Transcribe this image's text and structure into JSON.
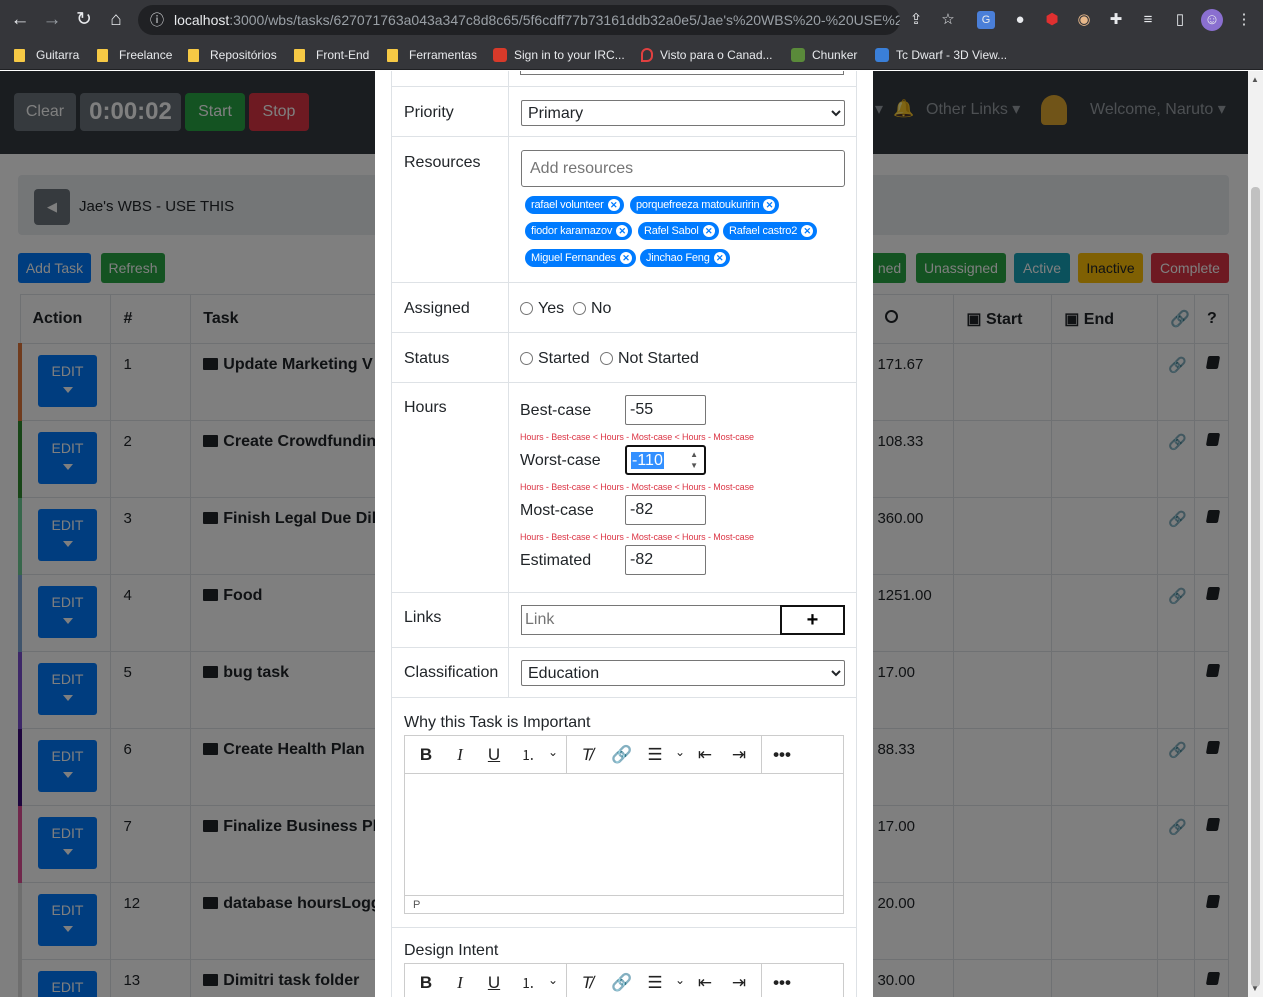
{
  "browser": {
    "url_host": "localhost",
    "url_rest": ":3000/wbs/tasks/627071763a043a347c8d8c65/5f6cdff77b73161ddb32a0e5/Jae's%20WBS%20-%20USE%2...",
    "bookmarks": [
      "Guitarra",
      "Freelance",
      "Repositórios",
      "Front-End",
      "Ferramentas",
      "Sign in to your IRC...",
      "Visto para o Canad...",
      "Chunker",
      "Tc Dwarf - 3D View..."
    ]
  },
  "topbar": {
    "clear": "Clear",
    "timer": "0:00:02",
    "start": "Start",
    "stop": "Stop",
    "other_links": "Other Links",
    "welcome": "Welcome, Naruto"
  },
  "breadcrumb": {
    "title": "Jae's WBS - USE THIS"
  },
  "filters": {
    "add_task": "Add Task",
    "refresh": "Refresh",
    "assigned": "ned",
    "unassigned": "Unassigned",
    "active": "Active",
    "inactive": "Inactive",
    "complete": "Complete"
  },
  "table": {
    "headers": {
      "action": "Action",
      "num": "#",
      "task": "Task",
      "start": "Start",
      "end": "End",
      "help": "?"
    },
    "edit_label": "EDIT",
    "rows": [
      {
        "num": "1",
        "task": "Update Marketing V",
        "hours": "171.67",
        "link": true,
        "color": "#e0763a"
      },
      {
        "num": "2",
        "task": "Create Crowdfundin",
        "hours": "108.33",
        "link": true,
        "color": "#2f8a2f"
      },
      {
        "num": "3",
        "task": "Finish Legal Due Dili",
        "hours": "360.00",
        "link": true,
        "color": "#6fcf97"
      },
      {
        "num": "4",
        "task": "Food",
        "hours": "1251.00",
        "link": true,
        "color": "#7fa8d8"
      },
      {
        "num": "5",
        "task": "bug task",
        "hours": "17.00",
        "link": false,
        "color": "#7a4fd0"
      },
      {
        "num": "6",
        "task": "Create Health Plan",
        "hours": "88.33",
        "link": true,
        "color": "#3b0a7a"
      },
      {
        "num": "7",
        "task": "Finalize Business Pla",
        "hours": "17.00",
        "link": true,
        "color": "#e04f96"
      },
      {
        "num": "12",
        "task": "database hoursLogg",
        "hours": "20.00",
        "link": false,
        "color": "#dddddd"
      },
      {
        "num": "13",
        "task": "Dimitri task folder",
        "hours": "30.00",
        "link": false,
        "color": "#dddddd"
      }
    ]
  },
  "modal": {
    "priority_label": "Priority",
    "priority_value": "Primary",
    "resources_label": "Resources",
    "resources_placeholder": "Add resources",
    "resources": [
      "rafael volunteer",
      "porquefreeza matoukuririn",
      "fiodor karamazov",
      "Rafel Sabol",
      "Rafael castro2",
      "Miguel Fernandes",
      "Jinchao Feng"
    ],
    "assigned_label": "Assigned",
    "yes": "Yes",
    "no": "No",
    "status_label": "Status",
    "started": "Started",
    "not_started": "Not Started",
    "hours_label": "Hours",
    "best_label": "Best-case",
    "best_value": "-55",
    "worst_label": "Worst-case",
    "worst_value": "-110",
    "most_label": "Most-case",
    "most_value": "-82",
    "est_label": "Estimated",
    "est_value": "-82",
    "hint": "Hours - Best-case < Hours - Most-case < Hours - Most-case",
    "links_label": "Links",
    "link_placeholder": "Link",
    "add_link": "+",
    "classification_label": "Classification",
    "classification_value": "Education",
    "why_label": "Why this Task is Important",
    "editor_status": "P",
    "design_label": "Design Intent"
  }
}
